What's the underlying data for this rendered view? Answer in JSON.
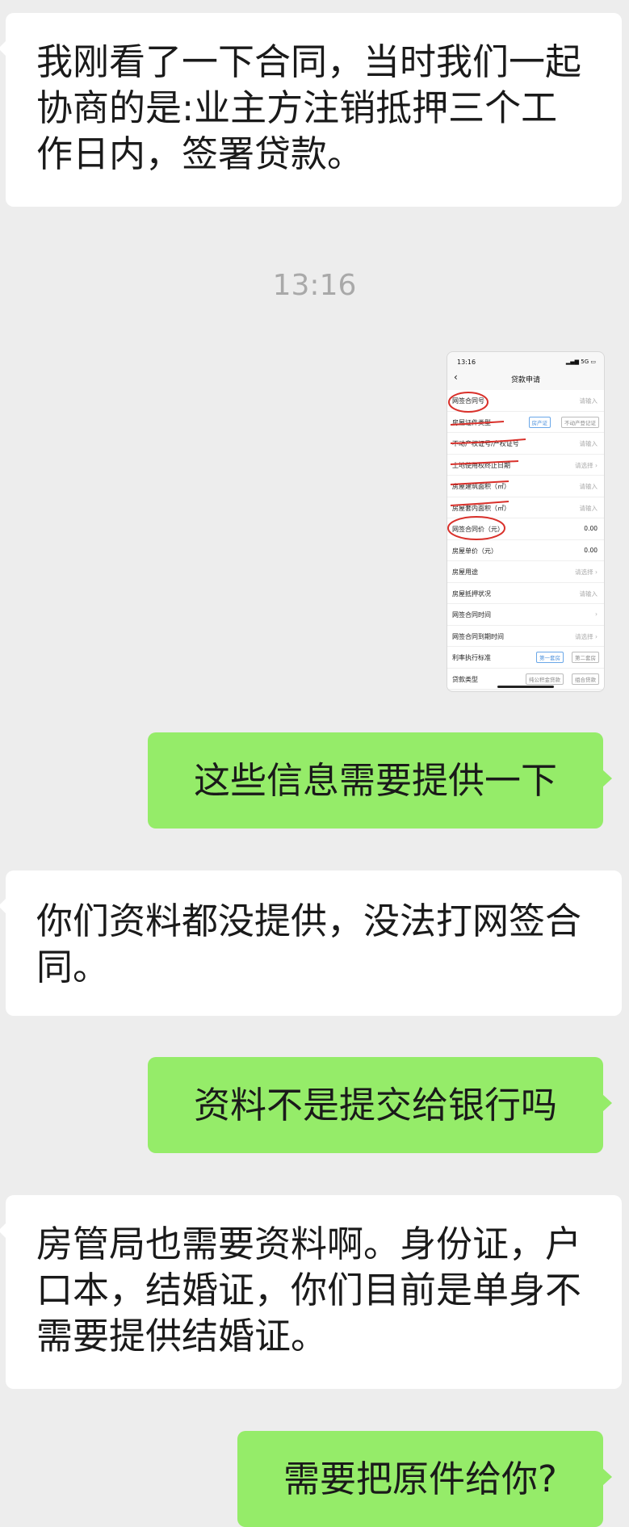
{
  "messages": {
    "m1": "我刚看了一下合同，当时我们一起协商的是:业主方注销抵押三个工作日内，签署贷款。",
    "m2": "这些信息需要提供一下",
    "m3": "你们资料都没提供，没法打网签合同。",
    "m4": "资料不是提交给银行吗",
    "m5": "房管局也需要资料啊。身份证，户口本，结婚证，你们目前是单身不需要提供结婚证。",
    "m6": "需要把原件给你?"
  },
  "timestamp": "13:16",
  "screenshot": {
    "status_time": "13:16",
    "status_signal": "5G",
    "title": "贷款申请",
    "rows": [
      {
        "label": "网签合同号",
        "value": "请输入"
      },
      {
        "label": "房屋证件类型",
        "chips": [
          "房产证",
          "不动产登记证"
        ]
      },
      {
        "label": "不动产权证号/产权证号",
        "value": "请输入"
      },
      {
        "label": "土地使用权终止日期",
        "value": "请选择 ›"
      },
      {
        "label": "房屋建筑面积（㎡）",
        "value": "请输入"
      },
      {
        "label": "房屋套内面积（㎡）",
        "value": "请输入"
      },
      {
        "label": "网签合同价（元）",
        "value": "0.00"
      },
      {
        "label": "房屋单价（元）",
        "value": "0.00"
      },
      {
        "label": "房屋用途",
        "value": "请选择 ›"
      },
      {
        "label": "房屋抵押状况",
        "value": "请输入"
      },
      {
        "label": "网签合同时间",
        "value": "›"
      },
      {
        "label": "网签合同到期时间",
        "value": "请选择 ›"
      },
      {
        "label": "利率执行标准",
        "chips": [
          "第一套房",
          "第二套房"
        ]
      },
      {
        "label": "贷款类型",
        "chips": [
          "纯公积金贷款",
          "组合贷款"
        ]
      }
    ]
  }
}
